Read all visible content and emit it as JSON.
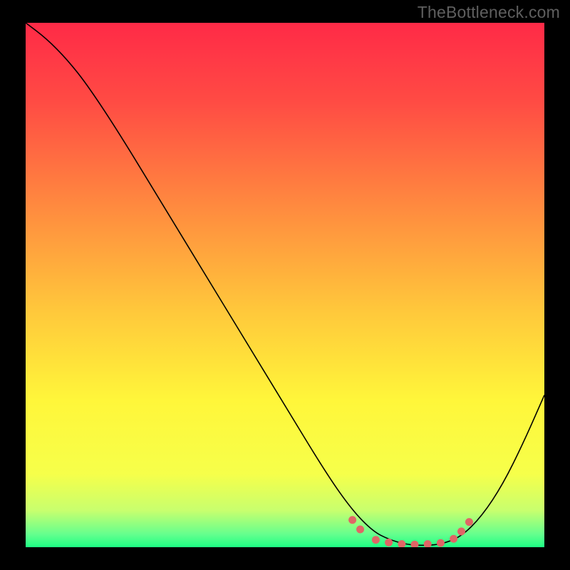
{
  "watermark": "TheBottleneck.com",
  "chart_data": {
    "type": "line",
    "title": "",
    "xlabel": "",
    "ylabel": "",
    "xlim": [
      0,
      100
    ],
    "ylim": [
      0,
      100
    ],
    "gradient_stops": [
      {
        "offset": 0.0,
        "color": "#ff2a47"
      },
      {
        "offset": 0.15,
        "color": "#ff4b44"
      },
      {
        "offset": 0.35,
        "color": "#ff8a3f"
      },
      {
        "offset": 0.55,
        "color": "#ffc83b"
      },
      {
        "offset": 0.72,
        "color": "#fff63a"
      },
      {
        "offset": 0.86,
        "color": "#f6ff4a"
      },
      {
        "offset": 0.93,
        "color": "#c8ff6e"
      },
      {
        "offset": 0.975,
        "color": "#66ff8e"
      },
      {
        "offset": 1.0,
        "color": "#1dff84"
      }
    ],
    "series": [
      {
        "name": "curve",
        "stroke": "#000000",
        "stroke_width": 1.6,
        "x": [
          0,
          4,
          8,
          12,
          18,
          26,
          34,
          42,
          50,
          58,
          63,
          67,
          70,
          73,
          76,
          80,
          84,
          88,
          92,
          96,
          100
        ],
        "values": [
          100,
          97,
          93,
          88,
          79,
          66,
          53,
          40,
          27,
          14,
          7,
          3,
          1.5,
          0.6,
          0.3,
          0.5,
          2,
          6,
          12,
          20,
          29
        ]
      }
    ],
    "highlight_dots": {
      "color": "#e06666",
      "radius": 5.5,
      "points": [
        {
          "x": 63.0,
          "y": 5.2
        },
        {
          "x": 64.5,
          "y": 3.4
        },
        {
          "x": 67.5,
          "y": 1.4
        },
        {
          "x": 70.0,
          "y": 0.9
        },
        {
          "x": 72.5,
          "y": 0.6
        },
        {
          "x": 75.0,
          "y": 0.5
        },
        {
          "x": 77.5,
          "y": 0.6
        },
        {
          "x": 80.0,
          "y": 0.8
        },
        {
          "x": 82.5,
          "y": 1.6
        },
        {
          "x": 84.0,
          "y": 3.0
        },
        {
          "x": 85.5,
          "y": 4.8
        }
      ]
    }
  }
}
